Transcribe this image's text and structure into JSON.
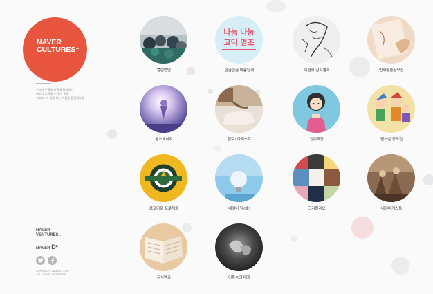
{
  "brand": {
    "logo_line1": "NAVER",
    "logo_line2": "CULTURES",
    "logo_mark": "™",
    "accent": "#e8553f",
    "tagline": [
      "인터넷 문화의 성장에 필요하는",
      "아무나 시작할 수 있는 일들",
      "어쩌 다 그 일을 하는 이들을 응원합니다"
    ]
  },
  "footer": {
    "ventures_line1": "NAVER",
    "ventures_line2": "VENTURES",
    "ventures_mark": "™",
    "naver_d2_prefix": "NAVER",
    "naver_d2_mark": "D²",
    "copyright_line1": "COPYRIGHT NAVER CORP.",
    "copyright_line2": "ALL RIGHTS RESERVED"
  },
  "grid": {
    "items": [
      {
        "label": "열린연단",
        "icon": "lecture-audience-photo"
      },
      {
        "label": "한글한글 아름답게",
        "icon": "nanum-font-poster"
      },
      {
        "label": "이현세 감작캠프",
        "icon": "manga-sketch"
      },
      {
        "label": "만화평론공모전",
        "icon": "hand-drawing-photo"
      },
      {
        "label": "온스테이지",
        "icon": "concert-stage-photo"
      },
      {
        "label": "헬로! 아티스트",
        "icon": "artist-painting-photo"
      },
      {
        "label": "인디극장",
        "icon": "animated-girl-illustration"
      },
      {
        "label": "웹소설 공모전",
        "icon": "comic-characters-illustration"
      },
      {
        "label": "로고어프 프로젝트",
        "icon": "emblem-badge"
      },
      {
        "label": "네이버 담(談)",
        "icon": "lightbulb-photo"
      },
      {
        "label": "그라폴리오",
        "icon": "art-collage"
      },
      {
        "label": "네이버캐스트",
        "icon": "old-painting"
      },
      {
        "label": "지식백과",
        "icon": "open-book-photo"
      },
      {
        "label": "어둠속의 대화",
        "icon": "dark-hands-photo"
      }
    ]
  }
}
